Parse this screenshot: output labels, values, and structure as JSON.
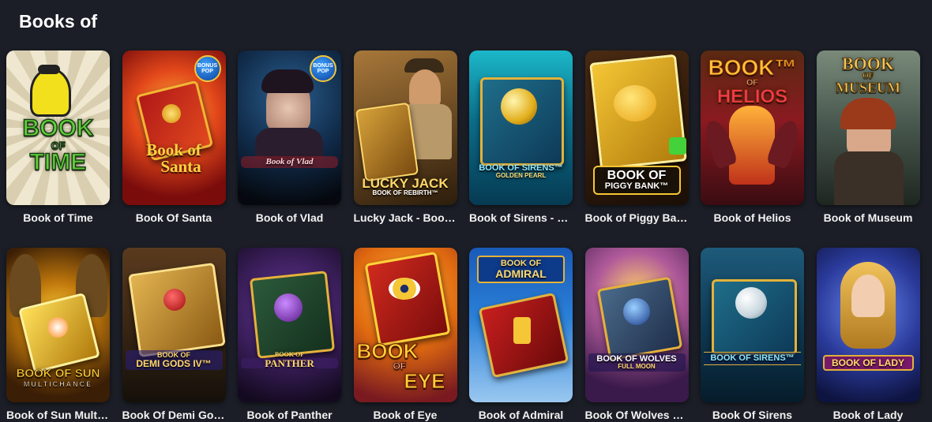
{
  "section": {
    "title": "Books of"
  },
  "games": [
    {
      "label": "Book of Time",
      "art": {
        "text_lines": [
          "BOOK",
          "OF",
          "TIME"
        ]
      }
    },
    {
      "label": "Book Of Santa",
      "art": {
        "text_lines": [
          "Book of",
          "Santa"
        ],
        "badge": "BONUS POP"
      }
    },
    {
      "label": "Book of Vlad",
      "art": {
        "text_lines": [
          "Book of Vlad"
        ],
        "badge": "BONUS POP"
      }
    },
    {
      "label": "Lucky Jack - Book…",
      "art": {
        "text_lines": [
          "LUCKY JACK",
          "BOOK OF REBIRTH™"
        ]
      }
    },
    {
      "label": "Book of Sirens - G…",
      "art": {
        "text_lines": [
          "BOOK OF SIRENS™",
          "GOLDEN PEARL"
        ]
      }
    },
    {
      "label": "Book of Piggy Bank",
      "art": {
        "text_lines": [
          "BOOK OF",
          "PIGGY BANK™"
        ]
      }
    },
    {
      "label": "Book of Helios",
      "art": {
        "text_lines": [
          "BOOK™",
          "OF",
          "HELIOS"
        ]
      }
    },
    {
      "label": "Book of Museum",
      "art": {
        "text_lines": [
          "BOOK",
          "OF",
          "MUSEUM"
        ]
      }
    },
    {
      "label": "Book of Sun Multi…",
      "art": {
        "text_lines": [
          "BOOK OF SUN",
          "MULTICHANCE"
        ]
      }
    },
    {
      "label": "Book Of Demi God…",
      "art": {
        "text_lines": [
          "BOOK OF",
          "DEMI GODS IV™"
        ]
      }
    },
    {
      "label": "Book of Panther",
      "art": {
        "text_lines": [
          "BOOK OF",
          "PANTHER"
        ]
      }
    },
    {
      "label": "Book of Eye",
      "art": {
        "text_lines": [
          "BOOK",
          "OF",
          "EYE"
        ]
      }
    },
    {
      "label": "Book of Admiral",
      "art": {
        "text_lines": [
          "BOOK OF",
          "ADMIRAL"
        ]
      }
    },
    {
      "label": "Book Of Wolves – …",
      "art": {
        "text_lines": [
          "BOOK OF WOLVES",
          "FULL MOON"
        ]
      }
    },
    {
      "label": "Book Of Sirens",
      "art": {
        "text_lines": [
          "BOOK OF SIRENS™"
        ]
      }
    },
    {
      "label": "Book of Lady",
      "art": {
        "text_lines": [
          "BOOK OF LADY"
        ]
      }
    }
  ]
}
